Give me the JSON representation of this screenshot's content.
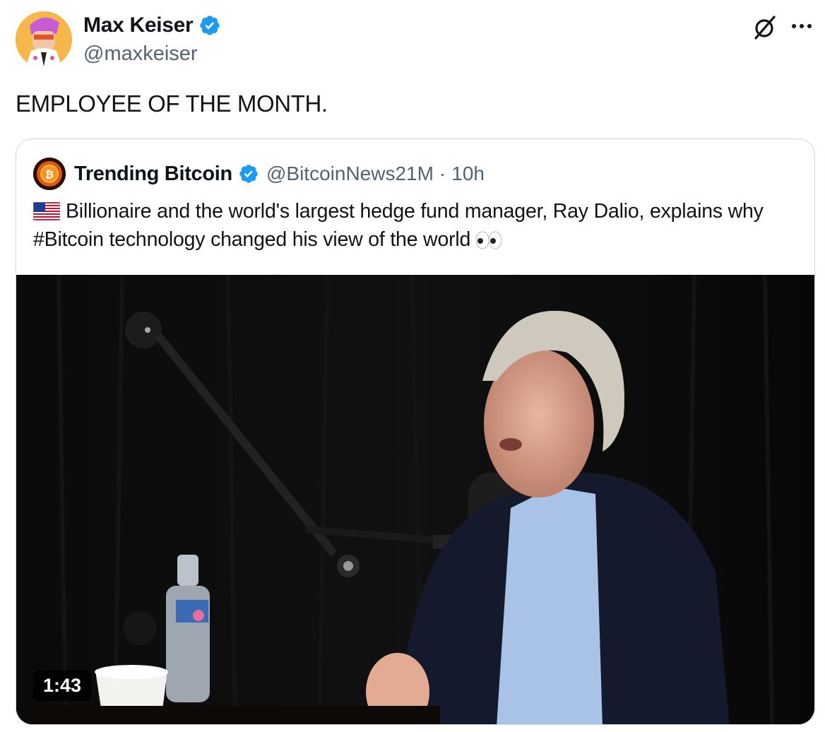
{
  "author": {
    "name": "Max Keiser",
    "handle": "@maxkeiser"
  },
  "tweet": {
    "text": "EMPLOYEE OF THE MONTH."
  },
  "quoted": {
    "name": "Trending Bitcoin",
    "handle": "@BitcoinNews21M",
    "separator": "·",
    "time": "10h",
    "text": "Billionaire and the world's largest hedge fund manager, Ray Dalio, explains why #Bitcoin technology changed his view of the world",
    "video_duration": "1:43"
  },
  "icons": {
    "verified": "verified-badge-icon",
    "grok": "grok-icon",
    "more": "more-icon",
    "flag": "us-flag-emoji",
    "eyes": "eyes-emoji"
  },
  "colors": {
    "verified_blue": "#1d9bf0",
    "secondary_text": "#536471",
    "border": "#cfd9de"
  }
}
